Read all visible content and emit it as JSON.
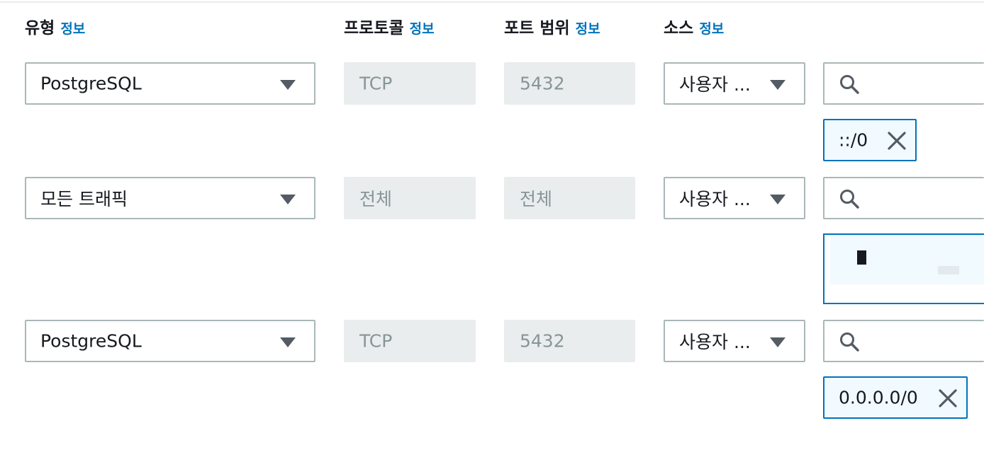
{
  "headers": {
    "type": "유형",
    "protocol": "프로토콜",
    "port_range": "포트 범위",
    "source": "소스",
    "info_link": "정보"
  },
  "rules": [
    {
      "type": "PostgreSQL",
      "protocol": "TCP",
      "port_range": "5432",
      "source": "사용자 ...",
      "tokens": [
        "::/0"
      ]
    },
    {
      "type": "모든 트래픽",
      "protocol": "전체",
      "port_range": "전체",
      "source": "사용자 ...",
      "tokens": []
    },
    {
      "type": "PostgreSQL",
      "protocol": "TCP",
      "port_range": "5432",
      "source": "사용자 ...",
      "tokens": [
        "0.0.0.0/0"
      ]
    }
  ],
  "icons": {
    "search": "search-icon",
    "remove": "close-icon",
    "dropdown": "caret-down-icon"
  },
  "colors": {
    "link": "#0073bb",
    "token_border": "#0073bb",
    "token_bg": "#f1faff",
    "disabled_bg": "#eaeded",
    "border": "#aab7b8"
  }
}
